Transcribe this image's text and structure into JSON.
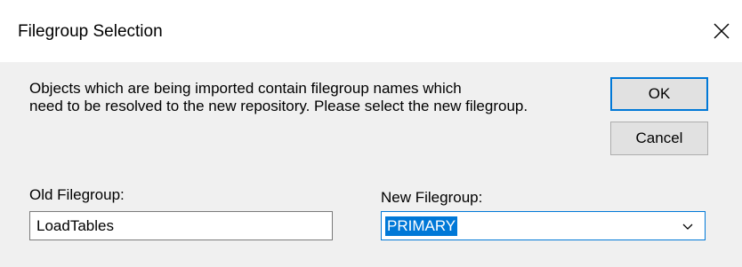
{
  "window": {
    "title": "Filegroup Selection"
  },
  "dialog": {
    "message": "Objects which are being imported contain filegroup names which\nneed to be resolved to the new repository. Please select the new filegroup.",
    "ok_label": "OK",
    "cancel_label": "Cancel",
    "old_filegroup_label": "Old Filegroup:",
    "old_filegroup_value": "LoadTables",
    "new_filegroup_label": "New Filegroup:",
    "new_filegroup_value": "PRIMARY"
  },
  "icons": {
    "close": "close-icon",
    "dropdown": "chevron-down-icon"
  },
  "colors": {
    "accent": "#0078d7",
    "dialog_background": "#f0f0f0",
    "button_background": "#e1e1e1"
  }
}
